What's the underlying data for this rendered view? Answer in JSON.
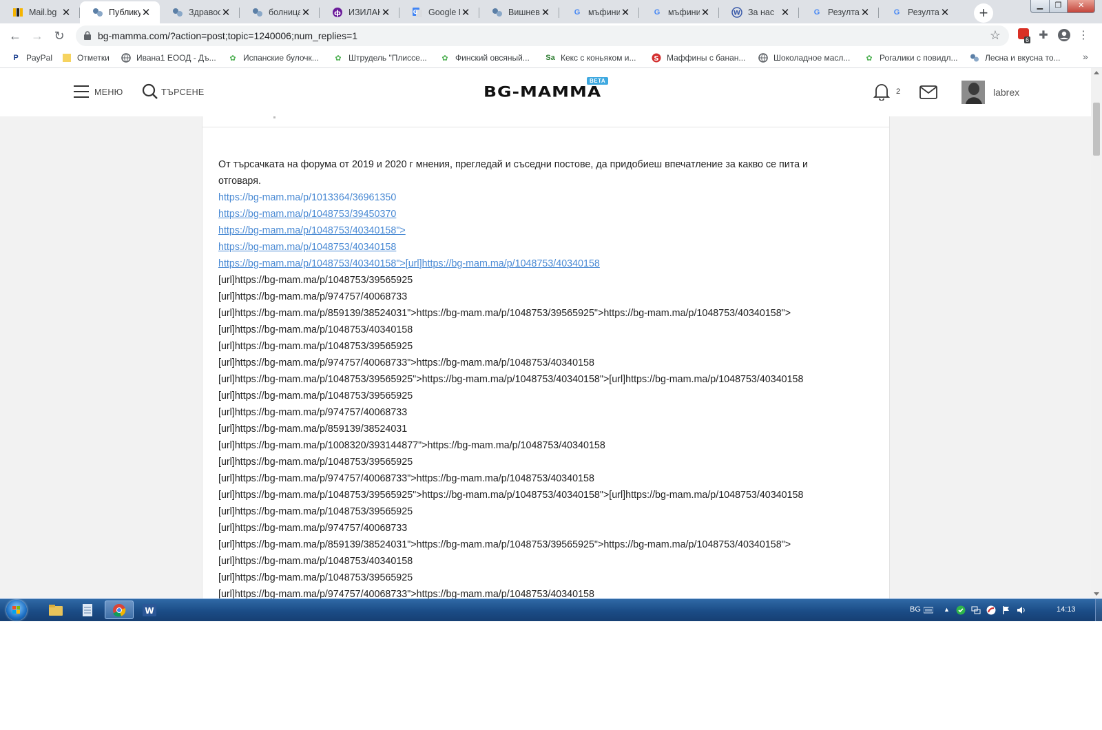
{
  "browser": {
    "tabs": [
      {
        "title": "Mail.bg",
        "icon": "mailbg-icon",
        "active": false
      },
      {
        "title": "Публикува",
        "icon": "bgmamma-icon",
        "active": true
      },
      {
        "title": "Здравосл",
        "icon": "bgmamma-icon",
        "active": false
      },
      {
        "title": "болница",
        "icon": "bgmamma-icon",
        "active": false
      },
      {
        "title": "ИЗИЛАКС",
        "icon": "izilaks-icon",
        "active": false
      },
      {
        "title": "Google Пр",
        "icon": "google-translate-icon",
        "active": false
      },
      {
        "title": "Вишнев п",
        "icon": "bgmamma-icon",
        "active": false
      },
      {
        "title": "мъфини с",
        "icon": "google-icon",
        "active": false
      },
      {
        "title": "мъфини л",
        "icon": "google-icon",
        "active": false
      },
      {
        "title": "За нас",
        "icon": "site-icon",
        "active": false
      },
      {
        "title": "Резултат",
        "icon": "google-icon",
        "active": false
      },
      {
        "title": "Резултат",
        "icon": "google-icon",
        "active": false
      }
    ],
    "new_tab_glyph": "+",
    "url": "bg-mamma.com/?action=post;topic=1240006;num_replies=1",
    "extension_badge": "6",
    "bookmarks": [
      {
        "label": "PayPal",
        "icon": "paypal-icon"
      },
      {
        "label": "Отметки",
        "icon": "folder-icon"
      },
      {
        "label": "Ивана1 ЕООД - Дъ...",
        "icon": "globe-icon"
      },
      {
        "label": "Испанские булочк...",
        "icon": "recipe-icon"
      },
      {
        "label": "Штрудель \"Плиссе...",
        "icon": "recipe-icon"
      },
      {
        "label": "Финский овсяный...",
        "icon": "recipe-icon"
      },
      {
        "label": "Кекс с коньяком и...",
        "icon": "sa-icon"
      },
      {
        "label": "Маффины с банан...",
        "icon": "s-red-icon"
      },
      {
        "label": "Шоколадное масл...",
        "icon": "globe-icon"
      },
      {
        "label": "Рогалики с повидл...",
        "icon": "recipe-icon"
      },
      {
        "label": "Лесна и вкусна то...",
        "icon": "bgmamma-icon"
      }
    ],
    "bookmarks_more": "»"
  },
  "site": {
    "menu_label": "МЕНЮ",
    "search_label": "ТЪРСЕНЕ",
    "logo_text": "BG-MAMMA",
    "beta_label": "BETA",
    "notification_count": "2",
    "username": "labrex"
  },
  "post": {
    "intro": "От търсачката на форума от 2019 и 2020 г мнения, прегледай и съседни постове, да придобиеш впечатление за какво се пита и отговаря.",
    "links": [
      {
        "text": "https://bg-mam.ma/p/1013364/36961350",
        "underline": false
      },
      {
        "text": "https://bg-mam.ma/p/1048753/39450370",
        "underline": true
      },
      {
        "text": "https://bg-mam.ma/p/1048753/40340158\">",
        "underline": true
      },
      {
        "text": "https://bg-mam.ma/p/1048753/40340158",
        "underline": true
      },
      {
        "text": "https://bg-mam.ma/p/1048753/40340158\">[url]https://bg-mam.ma/p/1048753/40340158",
        "underline": true
      }
    ],
    "lines": [
      "[url]https://bg-mam.ma/p/1048753/39565925",
      "[url]https://bg-mam.ma/p/974757/40068733",
      "[url]https://bg-mam.ma/p/859139/38524031\">https://bg-mam.ma/p/1048753/39565925\">https://bg-mam.ma/p/1048753/40340158\">",
      "[url]https://bg-mam.ma/p/1048753/40340158",
      "[url]https://bg-mam.ma/p/1048753/39565925",
      "[url]https://bg-mam.ma/p/974757/40068733\">https://bg-mam.ma/p/1048753/40340158",
      "[url]https://bg-mam.ma/p/1048753/39565925\">https://bg-mam.ma/p/1048753/40340158\">[url]https://bg-mam.ma/p/1048753/40340158",
      "[url]https://bg-mam.ma/p/1048753/39565925",
      "[url]https://bg-mam.ma/p/974757/40068733",
      "[url]https://bg-mam.ma/p/859139/38524031",
      "[url]https://bg-mam.ma/p/1008320/393144877\">https://bg-mam.ma/p/1048753/40340158",
      "[url]https://bg-mam.ma/p/1048753/39565925",
      "[url]https://bg-mam.ma/p/974757/40068733\">https://bg-mam.ma/p/1048753/40340158",
      "[url]https://bg-mam.ma/p/1048753/39565925\">https://bg-mam.ma/p/1048753/40340158\">[url]https://bg-mam.ma/p/1048753/40340158",
      "[url]https://bg-mam.ma/p/1048753/39565925",
      "[url]https://bg-mam.ma/p/974757/40068733",
      "[url]https://bg-mam.ma/p/859139/38524031\">https://bg-mam.ma/p/1048753/39565925\">https://bg-mam.ma/p/1048753/40340158\">",
      "[url]https://bg-mam.ma/p/1048753/40340158",
      "[url]https://bg-mam.ma/p/1048753/39565925",
      "[url]https://bg-mam.ma/p/974757/40068733\">https://bg-mam.ma/p/1048753/40340158"
    ]
  },
  "taskbar": {
    "language": "BG",
    "time": "14:13",
    "apps": [
      "explorer-icon",
      "notepad-icon",
      "chrome-icon",
      "word-icon"
    ]
  },
  "colors": {
    "link": "#4a8ad4",
    "beta_badge": "#3fa9e0",
    "taskbar": "#1b4c86"
  }
}
